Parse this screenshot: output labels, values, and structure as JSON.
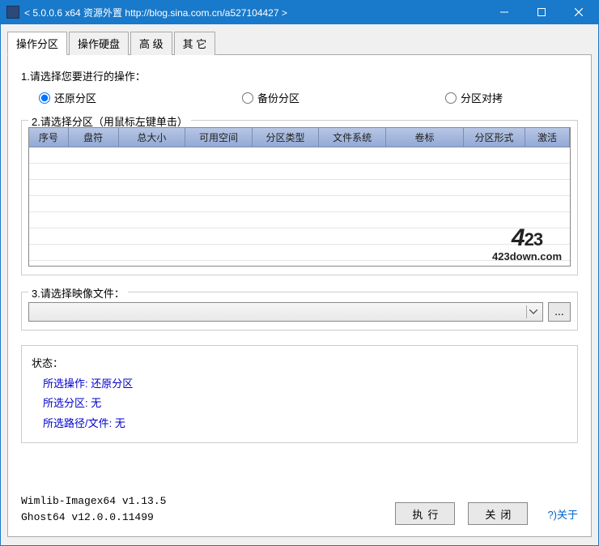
{
  "window": {
    "title": "< 5.0.0.6 x64 资源外置 http://blog.sina.com.cn/a527104427 >"
  },
  "tabs": [
    {
      "label": "操作分区",
      "active": true
    },
    {
      "label": "操作硬盘",
      "active": false
    },
    {
      "label": "高 级",
      "active": false
    },
    {
      "label": "其 它",
      "active": false
    }
  ],
  "section1": {
    "label": "1.请选择您要进行的操作：",
    "options": [
      {
        "label": "还原分区",
        "checked": true
      },
      {
        "label": "备份分区",
        "checked": false
      },
      {
        "label": "分区对拷",
        "checked": false
      }
    ]
  },
  "section2": {
    "legend": "2.请选择分区（用鼠标左键单击）",
    "columns": [
      "序号",
      "盘符",
      "总大小",
      "可用空间",
      "分区类型",
      "文件系统",
      "卷标",
      "分区形式",
      "激活"
    ]
  },
  "section3": {
    "legend": "3.请选择映像文件：",
    "browse_label": "..."
  },
  "status": {
    "title": "状态：",
    "line1_label": "所选操作:",
    "line1_value": "还原分区",
    "line2_label": "所选分区:",
    "line2_value": "无",
    "line3_label": "所选路径/文件:",
    "line3_value": "无"
  },
  "footer": {
    "version1": "Wimlib-Imagex64 v1.13.5",
    "version2": "Ghost64 v12.0.0.11499",
    "execute_label": "执行",
    "close_label": "关闭",
    "about_label": "?)关于"
  },
  "watermark": {
    "big": "423",
    "small": "423down.com"
  }
}
